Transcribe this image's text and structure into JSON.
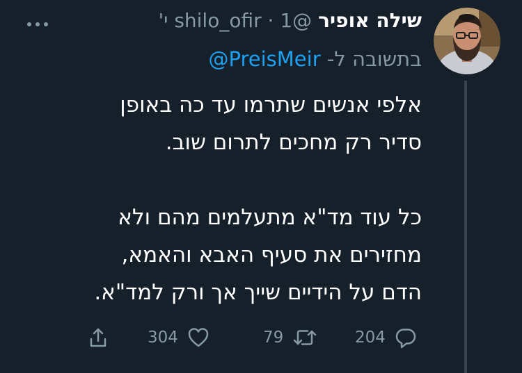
{
  "author": {
    "display_name": "שילה אופיר",
    "handle": "@shilo_ofir",
    "separator": "·",
    "time": "1 י'"
  },
  "reply_context": {
    "prefix": "בתשובה ל-",
    "handle": "@PreisMeir"
  },
  "tweet": {
    "paragraph_1": "אלפי אנשים שתרמו עד כה באופן\nסדיר רק מחכים לתרום שוב.",
    "paragraph_2": "כל עוד מד\"א מתעלמים מהם ולא\nמחזירים את סעיף האבא והאמא,\nהדם על הידיים שייך אך ורק למד\"א."
  },
  "actions": {
    "reply_count": "204",
    "retweet_count": "79",
    "like_count": "304"
  },
  "icons": {
    "more": "more-horizontal-icon",
    "reply": "reply-icon",
    "retweet": "retweet-icon",
    "like": "heart-icon",
    "share": "share-icon"
  },
  "colors": {
    "background": "#15202b",
    "primary_text": "#ffffff",
    "secondary_text": "#8899a6",
    "link": "#1da1f2",
    "thread_line": "#38444d"
  }
}
